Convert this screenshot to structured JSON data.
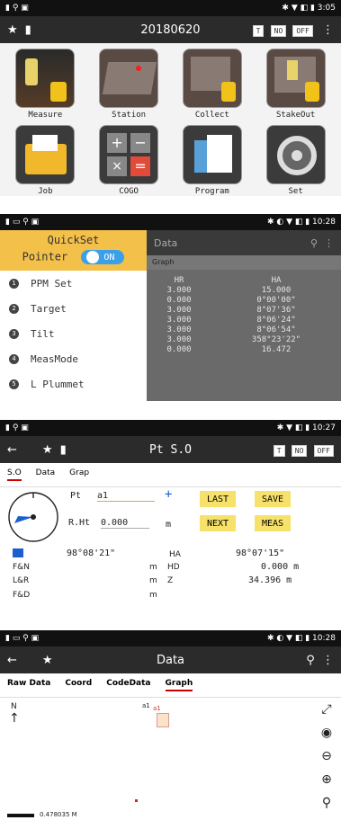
{
  "panel1": {
    "status_right": "✱ ▼ ◧ ▮ 3:05",
    "title": "20180620",
    "chips": [
      "T",
      "NO",
      "OFF"
    ],
    "tiles": [
      {
        "label": "Measure",
        "icon": "measure-icon"
      },
      {
        "label": "Station",
        "icon": "station-icon"
      },
      {
        "label": "Collect",
        "icon": "collect-icon"
      },
      {
        "label": "StakeOut",
        "icon": "stakeout-icon"
      },
      {
        "label": "Job",
        "icon": "folder-icon"
      },
      {
        "label": "COGO",
        "icon": "calculator-icon"
      },
      {
        "label": "Program",
        "icon": "document-icon"
      },
      {
        "label": "Set",
        "icon": "gear-icon"
      }
    ]
  },
  "panel2": {
    "status_right": "✱ ◐ ▼ ◧ ▮ 10:28",
    "quickset_title": "QuickSet",
    "pointer_label": "Pointer",
    "toggle_label": "ON",
    "items": [
      {
        "num": "1",
        "label": "PPM Set"
      },
      {
        "num": "2",
        "label": "Target"
      },
      {
        "num": "3",
        "label": "Tilt"
      },
      {
        "num": "4",
        "label": "MeasMode"
      },
      {
        "num": "5",
        "label": "L Plummet"
      }
    ],
    "bg_title": "Data",
    "bg_tab": "Graph",
    "headers": [
      "HR",
      "HA"
    ],
    "rows": [
      [
        "3.000",
        "15.000"
      ],
      [
        "0.000",
        "0°00'00\""
      ],
      [
        "3.000",
        "8°07'36\""
      ],
      [
        "3.000",
        "8°06'24\""
      ],
      [
        "3.000",
        "8°06'54\""
      ],
      [
        "3.000",
        "358°23'22\""
      ],
      [
        "0.000",
        "16.472"
      ]
    ]
  },
  "panel3": {
    "status_right": "✱ ▼ ◧ ▮ 10:27",
    "title": "Pt S.O",
    "chips": [
      "T",
      "NO",
      "OFF"
    ],
    "tabs": [
      "S.O",
      "Data",
      "Grap"
    ],
    "pt_label": "Pt",
    "pt_value": "a1",
    "plus_label": "+",
    "rht_label": "R.Ht",
    "rht_value": "0.000",
    "rht_unit": "m",
    "buttons": [
      "LAST",
      "SAVE",
      "NEXT",
      "MEAS"
    ],
    "arrow_angle": "98°08'21\"",
    "ha_label": "HA",
    "ha_value": "98°07'15\"",
    "rows": [
      {
        "left": "F&N",
        "unit": "m",
        "key": "HD",
        "value": "0.000 m"
      },
      {
        "left": "L&R",
        "unit": "m",
        "key": "Z",
        "value": "34.396 m"
      },
      {
        "left": "F&D",
        "unit": "m",
        "key": "",
        "value": ""
      }
    ]
  },
  "panel4": {
    "status_right": "✱ ◐ ▼ ◧ ▮ 10:28",
    "title": "Data",
    "tabs": [
      "Raw Data",
      "Coord",
      "CodeData",
      "Graph"
    ],
    "north_label": "N",
    "point_label": "a1",
    "point_label2": "a1",
    "scale_label": "0.478035 M"
  }
}
